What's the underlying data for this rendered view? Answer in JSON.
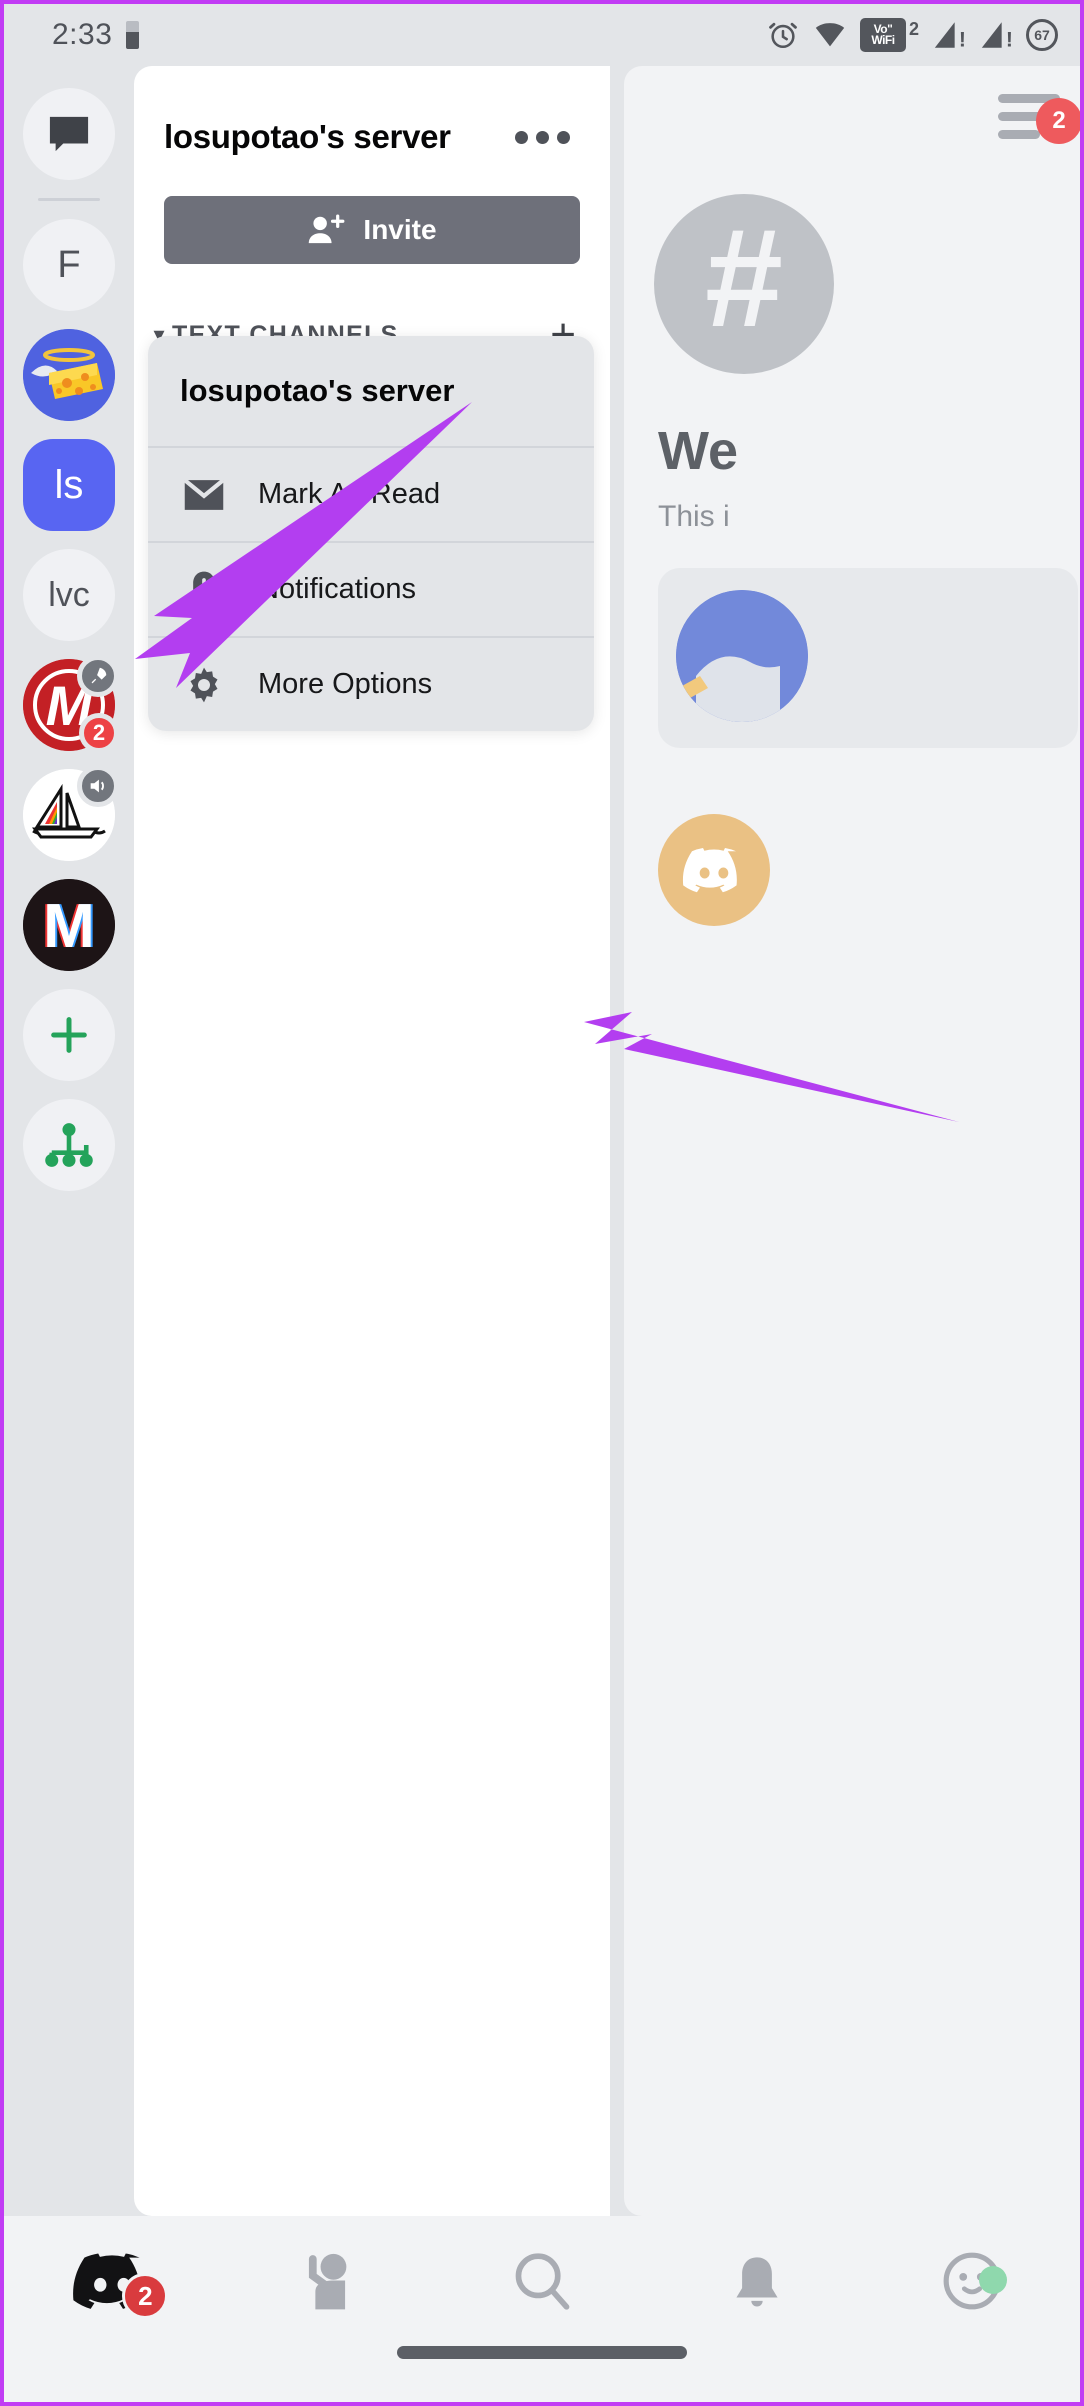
{
  "statusbar": {
    "clock": "2:33",
    "battery_icon": "battery-icon",
    "alarm_icon": "alarm-icon",
    "wifi_icon": "wifi-icon",
    "vowifi_line1": "Vo\"",
    "vowifi_line2": "WiFi",
    "vowifi_sup": "2",
    "signal1_icon": "signal-alert-icon",
    "signal2_icon": "signal-alert-icon",
    "battery_percent": "67"
  },
  "rail": {
    "items": [
      {
        "name": "direct-messages",
        "label": "",
        "icon": "chat-bubble-icon",
        "shape": "circle",
        "bg": "#f0f1f4",
        "selected": false,
        "unread": true,
        "badge": "",
        "mini_badge": ""
      },
      {
        "name": "server-f",
        "label": "F",
        "icon": "",
        "shape": "circle",
        "bg": "#f0f1f4",
        "selected": false,
        "unread": false,
        "badge": "",
        "mini_badge": ""
      },
      {
        "name": "server-cheese",
        "label": "",
        "icon": "cheese-angel-icon",
        "shape": "circle",
        "bg": "#4f62e0",
        "selected": false,
        "unread": true,
        "badge": "",
        "mini_badge": ""
      },
      {
        "name": "server-ls",
        "label": "ls",
        "icon": "",
        "shape": "squircle",
        "bg": "#5865f2",
        "selected": true,
        "unread": false,
        "badge": "",
        "mini_badge": ""
      },
      {
        "name": "server-lvc",
        "label": "lvc",
        "icon": "",
        "shape": "circle",
        "bg": "#f0f1f4",
        "selected": false,
        "unread": false,
        "badge": "",
        "mini_badge": ""
      },
      {
        "name": "server-m-red",
        "label": "",
        "icon": "m-red-logo-icon",
        "shape": "circle",
        "bg": "#c32025",
        "selected": false,
        "unread": true,
        "badge": "2",
        "mini_badge": "rocket-icon"
      },
      {
        "name": "server-sailboat",
        "label": "",
        "icon": "rainbow-sailboat-icon",
        "shape": "circle",
        "bg": "#ffffff",
        "selected": false,
        "unread": true,
        "badge": "",
        "mini_badge": "speaker-icon"
      },
      {
        "name": "server-m-dark",
        "label": "",
        "icon": "m-dark-logo-icon",
        "shape": "circle",
        "bg": "#1d1416",
        "selected": false,
        "unread": false,
        "badge": "",
        "mini_badge": ""
      },
      {
        "name": "add-server",
        "label": "",
        "icon": "plus-icon",
        "shape": "circle",
        "bg": "#f0f1f4",
        "selected": false,
        "unread": false,
        "badge": "",
        "mini_badge": ""
      },
      {
        "name": "explore-servers",
        "label": "",
        "icon": "explore-compass-icon",
        "shape": "circle",
        "bg": "#f0f1f4",
        "selected": false,
        "unread": false,
        "badge": "",
        "mini_badge": ""
      }
    ]
  },
  "panel": {
    "title": "losupotao's server",
    "overflow_icon": "more-horizontal-icon",
    "invite_label": "Invite",
    "invite_icon": "person-add-icon",
    "sections": [
      {
        "label": "TEXT CHANNELS",
        "chevron": "chevron-down-icon",
        "add_icon": "plus-icon"
      },
      {
        "label": "",
        "chevron": "chevron-down-icon",
        "add_icon": "plus-icon"
      }
    ]
  },
  "context_menu": {
    "header": "losupotao's server",
    "items": [
      {
        "label": "Mark As Read",
        "icon": "envelope-icon"
      },
      {
        "label": "Notifications",
        "icon": "bell-alert-icon"
      },
      {
        "label": "More Options",
        "icon": "gear-icon"
      }
    ]
  },
  "peek": {
    "hamburger_icon": "hamburger-menu-icon",
    "badge": "2",
    "channel_hash": "#",
    "welcome_heading": "We",
    "welcome_sub": "This i",
    "globe_icon": "globe-icon",
    "bot_icon": "discord-logo-icon"
  },
  "bottom_nav": {
    "items": [
      {
        "name": "nav-servers",
        "icon": "discord-logo-icon",
        "badge": "2",
        "status": ""
      },
      {
        "name": "nav-friends",
        "icon": "friends-icon",
        "badge": "",
        "status": ""
      },
      {
        "name": "nav-search",
        "icon": "search-icon",
        "badge": "",
        "status": ""
      },
      {
        "name": "nav-notifications",
        "icon": "bell-icon",
        "badge": "",
        "status": ""
      },
      {
        "name": "nav-profile",
        "icon": "avatar-face-icon",
        "badge": "",
        "status": "online"
      }
    ]
  },
  "annotations": {
    "arrow_color": "#b33ef0",
    "arrow_1_target": "server-ls",
    "arrow_2_target": "More Options"
  }
}
